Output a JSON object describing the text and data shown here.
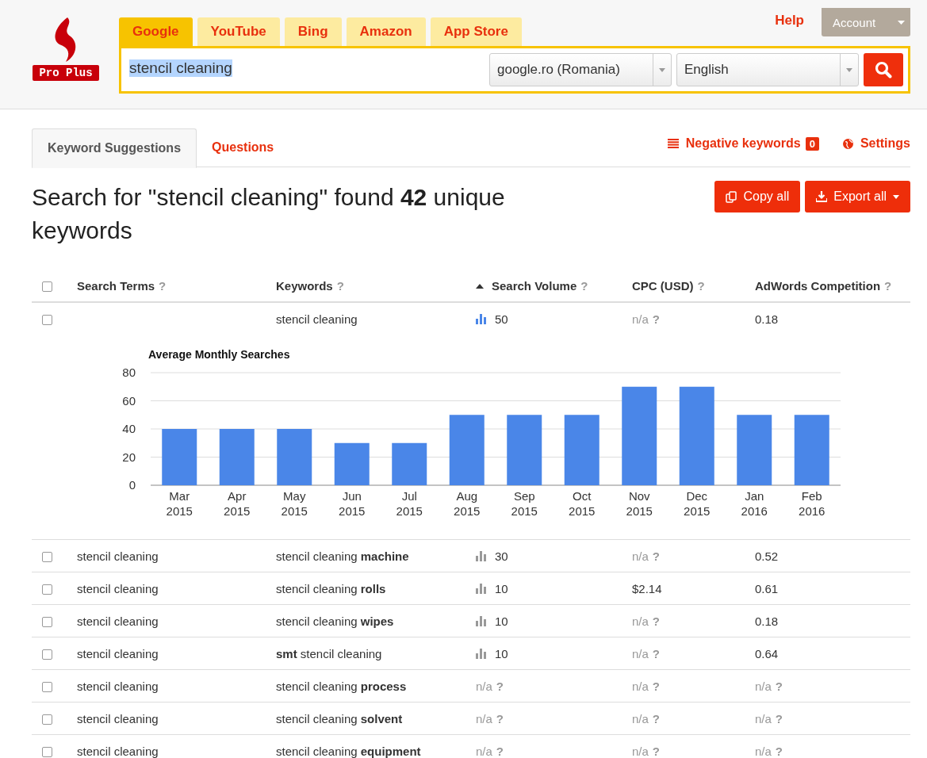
{
  "header": {
    "logo": {
      "text": "Pro Plus"
    },
    "engine_tabs": [
      {
        "label": "Google",
        "selected": true
      },
      {
        "label": "YouTube",
        "selected": false
      },
      {
        "label": "Bing",
        "selected": false
      },
      {
        "label": "Amazon",
        "selected": false
      },
      {
        "label": "App Store",
        "selected": false
      }
    ],
    "help": "Help",
    "account": "Account",
    "search": {
      "value": "stencil cleaning",
      "highlighted": true
    },
    "country_select": "google.ro (Romania)",
    "language_select": "English"
  },
  "tabs": [
    {
      "label": "Keyword Suggestions",
      "selected": true
    },
    {
      "label": "Questions",
      "selected": false
    }
  ],
  "negative_keywords": {
    "label": "Negative keywords",
    "count": "0"
  },
  "settings": "Settings",
  "heading": "Search for \"stencil cleaning\" found **42** unique keywords",
  "actions": [
    "Copy all",
    "Export all"
  ],
  "table": {
    "select_all": {
      "checked": false
    },
    "columns": [
      {
        "label": "Search Terms",
        "help": "?",
        "sorted": false
      },
      {
        "label": "Keywords",
        "help": "?",
        "sorted": false
      },
      {
        "label": "Search Volume",
        "help": "?",
        "sorted": true
      },
      {
        "label": "CPC (USD)",
        "help": "?",
        "sorted": false
      },
      {
        "label": "AdWords Competition",
        "help": "?",
        "sorted": false
      }
    ],
    "rows": [
      {
        "checked": false,
        "expanded": true,
        "search_term": "",
        "keyword": "stencil cleaning",
        "volume": {
          "value": "50"
        },
        "cpc": {
          "value": "n/a",
          "help": "?"
        },
        "competition": {
          "value": "0.18"
        },
        "chart_data": {
          "type": "bar",
          "title": "Average Monthly Searches",
          "categories": [
            "Mar 2015",
            "Apr 2015",
            "May 2015",
            "Jun 2015",
            "Jul 2015",
            "Aug 2015",
            "Sep 2015",
            "Oct 2015",
            "Nov 2015",
            "Dec 2015",
            "Jan 2016",
            "Feb 2016"
          ],
          "grid": true,
          "series": [
            {
              "color": "#4a86e8",
              "values": [
                40,
                40,
                40,
                30,
                30,
                50,
                50,
                50,
                70,
                70,
                50,
                50
              ]
            }
          ],
          "ylim": [
            0,
            80
          ],
          "yticks": [
            0,
            20,
            40,
            60,
            80
          ]
        }
      },
      {
        "checked": false,
        "expanded": false,
        "search_term": "stencil cleaning",
        "keyword": "stencil cleaning **machine**",
        "volume": {
          "value": "30"
        },
        "cpc": {
          "value": "n/a",
          "help": "?"
        },
        "competition": {
          "value": "0.52"
        }
      },
      {
        "checked": false,
        "expanded": false,
        "search_term": "stencil cleaning",
        "keyword": "stencil cleaning **rolls**",
        "volume": {
          "value": "10"
        },
        "cpc": {
          "value": "$2.14"
        },
        "competition": {
          "value": "0.61"
        }
      },
      {
        "checked": false,
        "expanded": false,
        "search_term": "stencil cleaning",
        "keyword": "stencil cleaning **wipes**",
        "volume": {
          "value": "10"
        },
        "cpc": {
          "value": "n/a",
          "help": "?"
        },
        "competition": {
          "value": "0.18"
        }
      },
      {
        "checked": false,
        "expanded": false,
        "search_term": "stencil cleaning",
        "keyword": "**smt** stencil cleaning",
        "volume": {
          "value": "10"
        },
        "cpc": {
          "value": "n/a",
          "help": "?"
        },
        "competition": {
          "value": "0.64"
        }
      },
      {
        "checked": false,
        "expanded": false,
        "search_term": "stencil cleaning",
        "keyword": "stencil cleaning **process**",
        "volume": {
          "value": "n/a",
          "help": "?"
        },
        "cpc": {
          "value": "n/a",
          "help": "?"
        },
        "competition": {
          "value": "n/a",
          "help": "?"
        }
      },
      {
        "checked": false,
        "expanded": false,
        "search_term": "stencil cleaning",
        "keyword": "stencil cleaning **solvent**",
        "volume": {
          "value": "n/a",
          "help": "?"
        },
        "cpc": {
          "value": "n/a",
          "help": "?"
        },
        "competition": {
          "value": "n/a",
          "help": "?"
        }
      },
      {
        "checked": false,
        "expanded": false,
        "search_term": "stencil cleaning",
        "keyword": "stencil cleaning **equipment**",
        "volume": {
          "value": "n/a",
          "help": "?"
        },
        "cpc": {
          "value": "n/a",
          "help": "?"
        },
        "competition": {
          "value": "n/a",
          "help": "?"
        }
      }
    ]
  }
}
